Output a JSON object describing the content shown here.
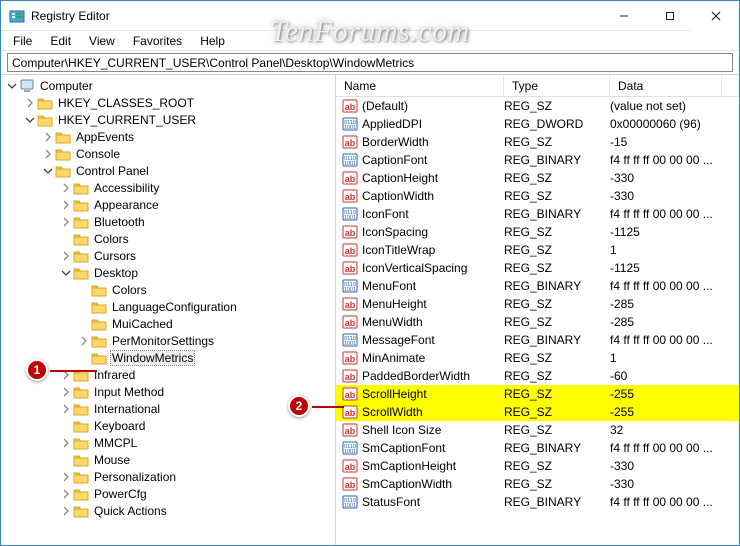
{
  "watermark": "TenForums.com",
  "window": {
    "title": "Registry Editor"
  },
  "menu": {
    "items": [
      "File",
      "Edit",
      "View",
      "Favorites",
      "Help"
    ]
  },
  "address": {
    "value": "Computer\\HKEY_CURRENT_USER\\Control Panel\\Desktop\\WindowMetrics"
  },
  "list": {
    "headers": {
      "name": "Name",
      "type": "Type",
      "data": "Data"
    },
    "rows": [
      {
        "icon": "str",
        "name": "(Default)",
        "type": "REG_SZ",
        "data": "(value not set)"
      },
      {
        "icon": "bin",
        "name": "AppliedDPI",
        "type": "REG_DWORD",
        "data": "0x00000060 (96)"
      },
      {
        "icon": "str",
        "name": "BorderWidth",
        "type": "REG_SZ",
        "data": "-15"
      },
      {
        "icon": "bin",
        "name": "CaptionFont",
        "type": "REG_BINARY",
        "data": "f4 ff ff ff 00 00 00 ..."
      },
      {
        "icon": "str",
        "name": "CaptionHeight",
        "type": "REG_SZ",
        "data": "-330"
      },
      {
        "icon": "str",
        "name": "CaptionWidth",
        "type": "REG_SZ",
        "data": "-330"
      },
      {
        "icon": "bin",
        "name": "IconFont",
        "type": "REG_BINARY",
        "data": "f4 ff ff ff 00 00 00 ..."
      },
      {
        "icon": "str",
        "name": "IconSpacing",
        "type": "REG_SZ",
        "data": "-1125"
      },
      {
        "icon": "str",
        "name": "IconTitleWrap",
        "type": "REG_SZ",
        "data": "1"
      },
      {
        "icon": "str",
        "name": "IconVerticalSpacing",
        "type": "REG_SZ",
        "data": "-1125"
      },
      {
        "icon": "bin",
        "name": "MenuFont",
        "type": "REG_BINARY",
        "data": "f4 ff ff ff 00 00 00 ..."
      },
      {
        "icon": "str",
        "name": "MenuHeight",
        "type": "REG_SZ",
        "data": "-285"
      },
      {
        "icon": "str",
        "name": "MenuWidth",
        "type": "REG_SZ",
        "data": "-285"
      },
      {
        "icon": "bin",
        "name": "MessageFont",
        "type": "REG_BINARY",
        "data": "f4 ff ff ff 00 00 00 ..."
      },
      {
        "icon": "str",
        "name": "MinAnimate",
        "type": "REG_SZ",
        "data": "1"
      },
      {
        "icon": "str",
        "name": "PaddedBorderWidth",
        "type": "REG_SZ",
        "data": "-60"
      },
      {
        "icon": "str",
        "name": "ScrollHeight",
        "type": "REG_SZ",
        "data": "-255",
        "hl": true
      },
      {
        "icon": "str",
        "name": "ScrollWidth",
        "type": "REG_SZ",
        "data": "-255",
        "hl": true
      },
      {
        "icon": "str",
        "name": "Shell Icon Size",
        "type": "REG_SZ",
        "data": "32"
      },
      {
        "icon": "bin",
        "name": "SmCaptionFont",
        "type": "REG_BINARY",
        "data": "f4 ff ff ff 00 00 00 ..."
      },
      {
        "icon": "str",
        "name": "SmCaptionHeight",
        "type": "REG_SZ",
        "data": "-330"
      },
      {
        "icon": "str",
        "name": "SmCaptionWidth",
        "type": "REG_SZ",
        "data": "-330"
      },
      {
        "icon": "bin",
        "name": "StatusFont",
        "type": "REG_BINARY",
        "data": "f4 ff ff ff 00 00 00 ..."
      }
    ]
  },
  "tree": [
    {
      "depth": 0,
      "chev": "open",
      "icon": "pc",
      "label": "Computer"
    },
    {
      "depth": 1,
      "chev": "closed",
      "icon": "folder",
      "label": "HKEY_CLASSES_ROOT"
    },
    {
      "depth": 1,
      "chev": "open",
      "icon": "folder",
      "label": "HKEY_CURRENT_USER"
    },
    {
      "depth": 2,
      "chev": "closed",
      "icon": "folder",
      "label": "AppEvents"
    },
    {
      "depth": 2,
      "chev": "closed",
      "icon": "folder",
      "label": "Console"
    },
    {
      "depth": 2,
      "chev": "open",
      "icon": "folder",
      "label": "Control Panel"
    },
    {
      "depth": 3,
      "chev": "closed",
      "icon": "folder",
      "label": "Accessibility"
    },
    {
      "depth": 3,
      "chev": "closed",
      "icon": "folder",
      "label": "Appearance"
    },
    {
      "depth": 3,
      "chev": "closed",
      "icon": "folder",
      "label": "Bluetooth"
    },
    {
      "depth": 3,
      "chev": "none",
      "icon": "folder",
      "label": "Colors"
    },
    {
      "depth": 3,
      "chev": "closed",
      "icon": "folder",
      "label": "Cursors"
    },
    {
      "depth": 3,
      "chev": "open",
      "icon": "folder",
      "label": "Desktop"
    },
    {
      "depth": 4,
      "chev": "none",
      "icon": "folder",
      "label": "Colors"
    },
    {
      "depth": 4,
      "chev": "none",
      "icon": "folder",
      "label": "LanguageConfiguration"
    },
    {
      "depth": 4,
      "chev": "none",
      "icon": "folder",
      "label": "MuiCached"
    },
    {
      "depth": 4,
      "chev": "closed",
      "icon": "folder",
      "label": "PerMonitorSettings"
    },
    {
      "depth": 4,
      "chev": "none",
      "icon": "folder",
      "label": "WindowMetrics",
      "selected": true
    },
    {
      "depth": 3,
      "chev": "closed",
      "icon": "folder",
      "label": "Infrared"
    },
    {
      "depth": 3,
      "chev": "closed",
      "icon": "folder",
      "label": "Input Method"
    },
    {
      "depth": 3,
      "chev": "closed",
      "icon": "folder",
      "label": "International"
    },
    {
      "depth": 3,
      "chev": "none",
      "icon": "folder",
      "label": "Keyboard"
    },
    {
      "depth": 3,
      "chev": "closed",
      "icon": "folder",
      "label": "MMCPL"
    },
    {
      "depth": 3,
      "chev": "none",
      "icon": "folder",
      "label": "Mouse"
    },
    {
      "depth": 3,
      "chev": "closed",
      "icon": "folder",
      "label": "Personalization"
    },
    {
      "depth": 3,
      "chev": "closed",
      "icon": "folder",
      "label": "PowerCfg"
    },
    {
      "depth": 3,
      "chev": "closed",
      "icon": "folder",
      "label": "Quick Actions"
    }
  ],
  "annotations": {
    "one": "1",
    "two": "2"
  }
}
